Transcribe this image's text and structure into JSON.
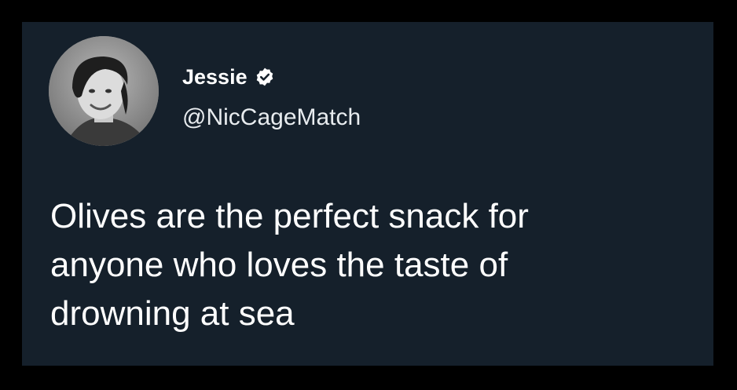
{
  "tweet": {
    "author": {
      "display_name": "Jessie",
      "handle": "@NicCageMatch",
      "verified": true,
      "avatar_icon": "profile-photo"
    },
    "text_lines": [
      "Olives are the perfect snack for",
      "anyone who loves the taste of",
      "drowning at sea"
    ]
  },
  "colors": {
    "background": "#000000",
    "card": "#15202b",
    "text": "#ffffff"
  }
}
